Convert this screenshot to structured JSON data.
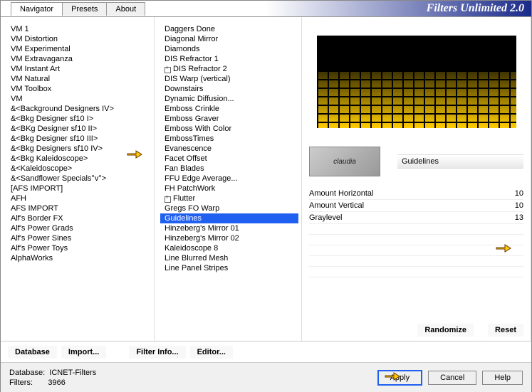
{
  "header": {
    "title": "Filters Unlimited 2.0"
  },
  "tabs": {
    "navigator": "Navigator",
    "presets": "Presets",
    "about": "About"
  },
  "lists": {
    "left": [
      "VM 1",
      "VM Distortion",
      "VM Experimental",
      "VM Extravaganza",
      "VM Instant Art",
      "VM Natural",
      "VM Toolbox",
      "VM",
      "&<Background Designers IV>",
      "&<Bkg Designer sf10 I>",
      "&<BKg Designer sf10 II>",
      "&<Bkg Designer sf10 III>",
      "&<Bkg Designers sf10 IV>",
      "&<Bkg Kaleidoscope>",
      "&<Kaleidoscope>",
      "&<Sandflower Specials°v°>",
      "[AFS IMPORT]",
      "AFH",
      "AFS IMPORT",
      "Alf's Border FX",
      "Alf's Power Grads",
      "Alf's Power Sines",
      "Alf's Power Toys",
      "AlphaWorks"
    ],
    "right": [
      {
        "t": "Daggers Done"
      },
      {
        "t": "Diagonal Mirror"
      },
      {
        "t": "Diamonds"
      },
      {
        "t": "DIS Refractor 1"
      },
      {
        "t": "DIS Refractor 2",
        "tree": true
      },
      {
        "t": "DIS Warp (vertical)"
      },
      {
        "t": "Downstairs"
      },
      {
        "t": "Dynamic Diffusion..."
      },
      {
        "t": "Emboss Crinkle"
      },
      {
        "t": "Emboss Graver"
      },
      {
        "t": "Emboss With Color"
      },
      {
        "t": "EmbossTimes"
      },
      {
        "t": "Evanescence"
      },
      {
        "t": "Facet Offset"
      },
      {
        "t": "Fan Blades"
      },
      {
        "t": "FFU Edge Average..."
      },
      {
        "t": "FH PatchWork"
      },
      {
        "t": "Flutter",
        "tree": true
      },
      {
        "t": "Gregs FO Warp"
      },
      {
        "t": "Guidelines",
        "sel": true
      },
      {
        "t": "Hinzeberg's Mirror 01"
      },
      {
        "t": "Hinzeberg's Mirror 02"
      },
      {
        "t": "Kaleidoscope 8"
      },
      {
        "t": "Line Blurred Mesh"
      },
      {
        "t": "Line Panel Stripes"
      }
    ]
  },
  "toolbar": {
    "database": "Database",
    "import": "Import...",
    "filterinfo": "Filter Info...",
    "editor": "Editor...",
    "randomize": "Randomize",
    "reset": "Reset"
  },
  "filter": {
    "name": "Guidelines",
    "thumb_text": "claudia"
  },
  "params": [
    {
      "label": "Amount Horizontal",
      "value": "10"
    },
    {
      "label": "Amount Vertical",
      "value": "10"
    },
    {
      "label": "Graylevel",
      "value": "13"
    }
  ],
  "footer": {
    "db_label": "Database:",
    "db_value": "ICNET-Filters",
    "filters_label": "Filters:",
    "filters_value": "3966",
    "apply": "Apply",
    "cancel": "Cancel",
    "help": "Help"
  }
}
